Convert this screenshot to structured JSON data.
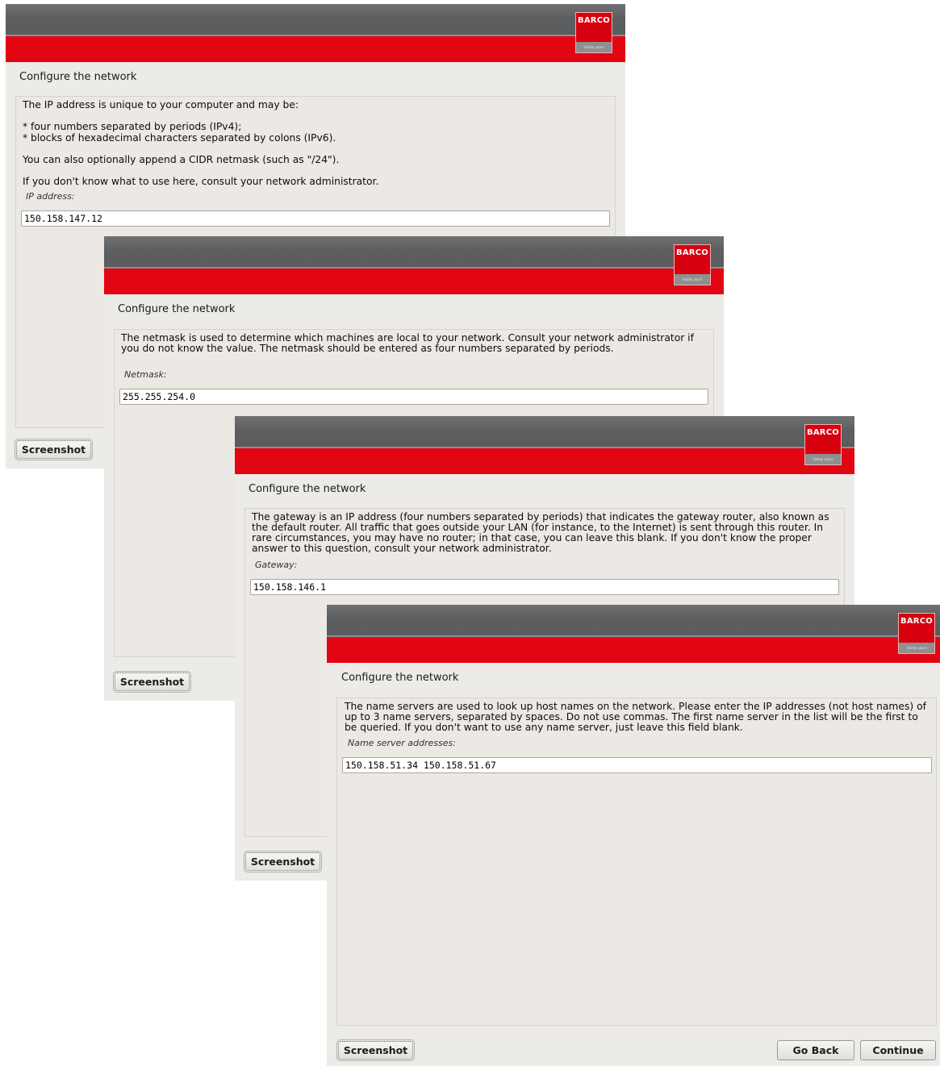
{
  "logo": {
    "text": "BARCO",
    "tagline": "Visibly yours"
  },
  "windows": [
    {
      "title": "Configure the network",
      "intro": "The IP address is unique to your computer and may be:",
      "bullet1": "* four numbers separated by periods (IPv4);",
      "bullet2": "* blocks of hexadecimal characters separated by colons (IPv6).",
      "cidr": "You can also optionally append a CIDR netmask (such as \"/24\").",
      "consult": "If you don't know what to use here, consult your network administrator.",
      "field_label": "IP address:",
      "field_value": "150.158.147.12",
      "screenshot_label": "Screenshot"
    },
    {
      "title": "Configure the network",
      "description": "The netmask is used to determine which machines are local to your network.  Consult your network administrator if you do not know the value.  The netmask should be entered as four numbers separated by periods.",
      "field_label": "Netmask:",
      "field_value": "255.255.254.0",
      "screenshot_label": "Screenshot"
    },
    {
      "title": "Configure the network",
      "description": "The gateway is an IP address (four numbers separated by periods) that indicates the gateway router, also known as the default router.  All traffic that goes outside your LAN (for instance, to the Internet) is sent through this router.  In rare circumstances, you may have no router; in that case, you can leave this blank.  If you don't know the proper answer to this question, consult your network administrator.",
      "field_label": "Gateway:",
      "field_value": "150.158.146.1",
      "screenshot_label": "Screenshot"
    },
    {
      "title": "Configure the network",
      "description": "The name servers are used to look up host names on the network. Please enter the IP addresses (not host names) of up to 3 name servers, separated by spaces. Do not use commas. The first name server in the list will be the first to be queried. If you don't want to use any name server, just leave this field blank.",
      "field_label": "Name server addresses:",
      "field_value": "150.158.51.34 150.158.51.67",
      "screenshot_label": "Screenshot",
      "go_back_label": "Go Back",
      "continue_label": "Continue"
    }
  ],
  "colors": {
    "banner_red": "#e20613",
    "banner_gray": "#5c5e60",
    "window_bg": "#edebe7"
  }
}
